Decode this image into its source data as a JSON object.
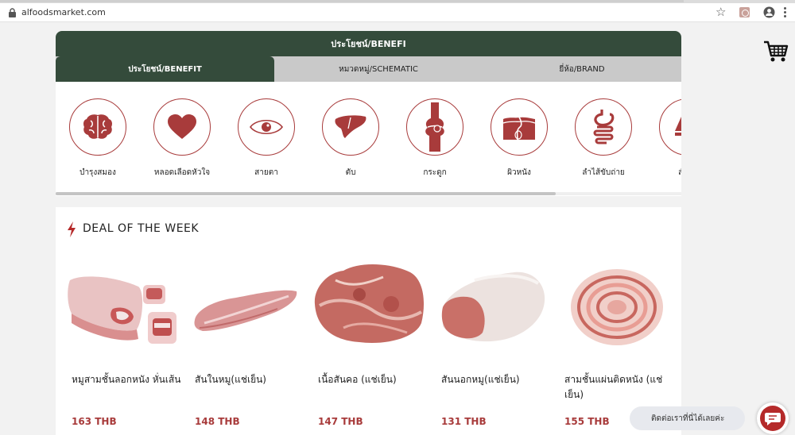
{
  "browser": {
    "url": "alfoodsmarket.com",
    "icons": [
      "lock-icon",
      "star-icon",
      "pdf-extension-icon",
      "profile-icon",
      "menu-icon"
    ]
  },
  "cart": {
    "icon": "cart-icon"
  },
  "benefit_panel": {
    "header": "ประโยชน์/BENEFI",
    "tabs": [
      {
        "label": "ประโยชน์/BENEFIT",
        "active": true
      },
      {
        "label": "หมวดหมู่/SCHEMATIC",
        "active": false
      },
      {
        "label": "ยี่ห้อ/BRAND",
        "active": false
      }
    ],
    "categories": [
      {
        "label": "บำรุงสมอง",
        "icon": "brain-icon"
      },
      {
        "label": "หลอดเลือดหัวใจ",
        "icon": "heart-icon"
      },
      {
        "label": "สายตา",
        "icon": "eye-icon"
      },
      {
        "label": "ตับ",
        "icon": "liver-icon"
      },
      {
        "label": "กระดูก",
        "icon": "bone-joint-icon"
      },
      {
        "label": "ผิวหนัง",
        "icon": "skin-icon"
      },
      {
        "label": "ลำไส้ขับถ่าย",
        "icon": "intestine-icon"
      },
      {
        "label": "สำหร",
        "icon": "partial-category-icon"
      }
    ]
  },
  "deal": {
    "title": "DEAL OF THE WEEK",
    "currency": "THB",
    "products": [
      {
        "name": "หมูสามชั้นลอกหนัง หั่นเส้น",
        "price": "163 THB"
      },
      {
        "name": "สันในหมู(แช่เย็น)",
        "price": "148 THB"
      },
      {
        "name": "เนื้อสันคอ (แช่เย็น)",
        "price": "147 THB"
      },
      {
        "name": "สันนอกหมู(แช่เย็น)",
        "price": "131 THB"
      },
      {
        "name": "สามชั้นแผ่นติดหนัง (แช่เย็น)",
        "price": "155 THB"
      }
    ]
  },
  "chat": {
    "label": "ติดต่อเราที่นี่ได้เลยค่ะ",
    "icon": "chat-icon"
  },
  "colors": {
    "header_green": "#344b3b",
    "accent_red": "#a83b3b",
    "tab_grey": "#c9c9c9"
  }
}
